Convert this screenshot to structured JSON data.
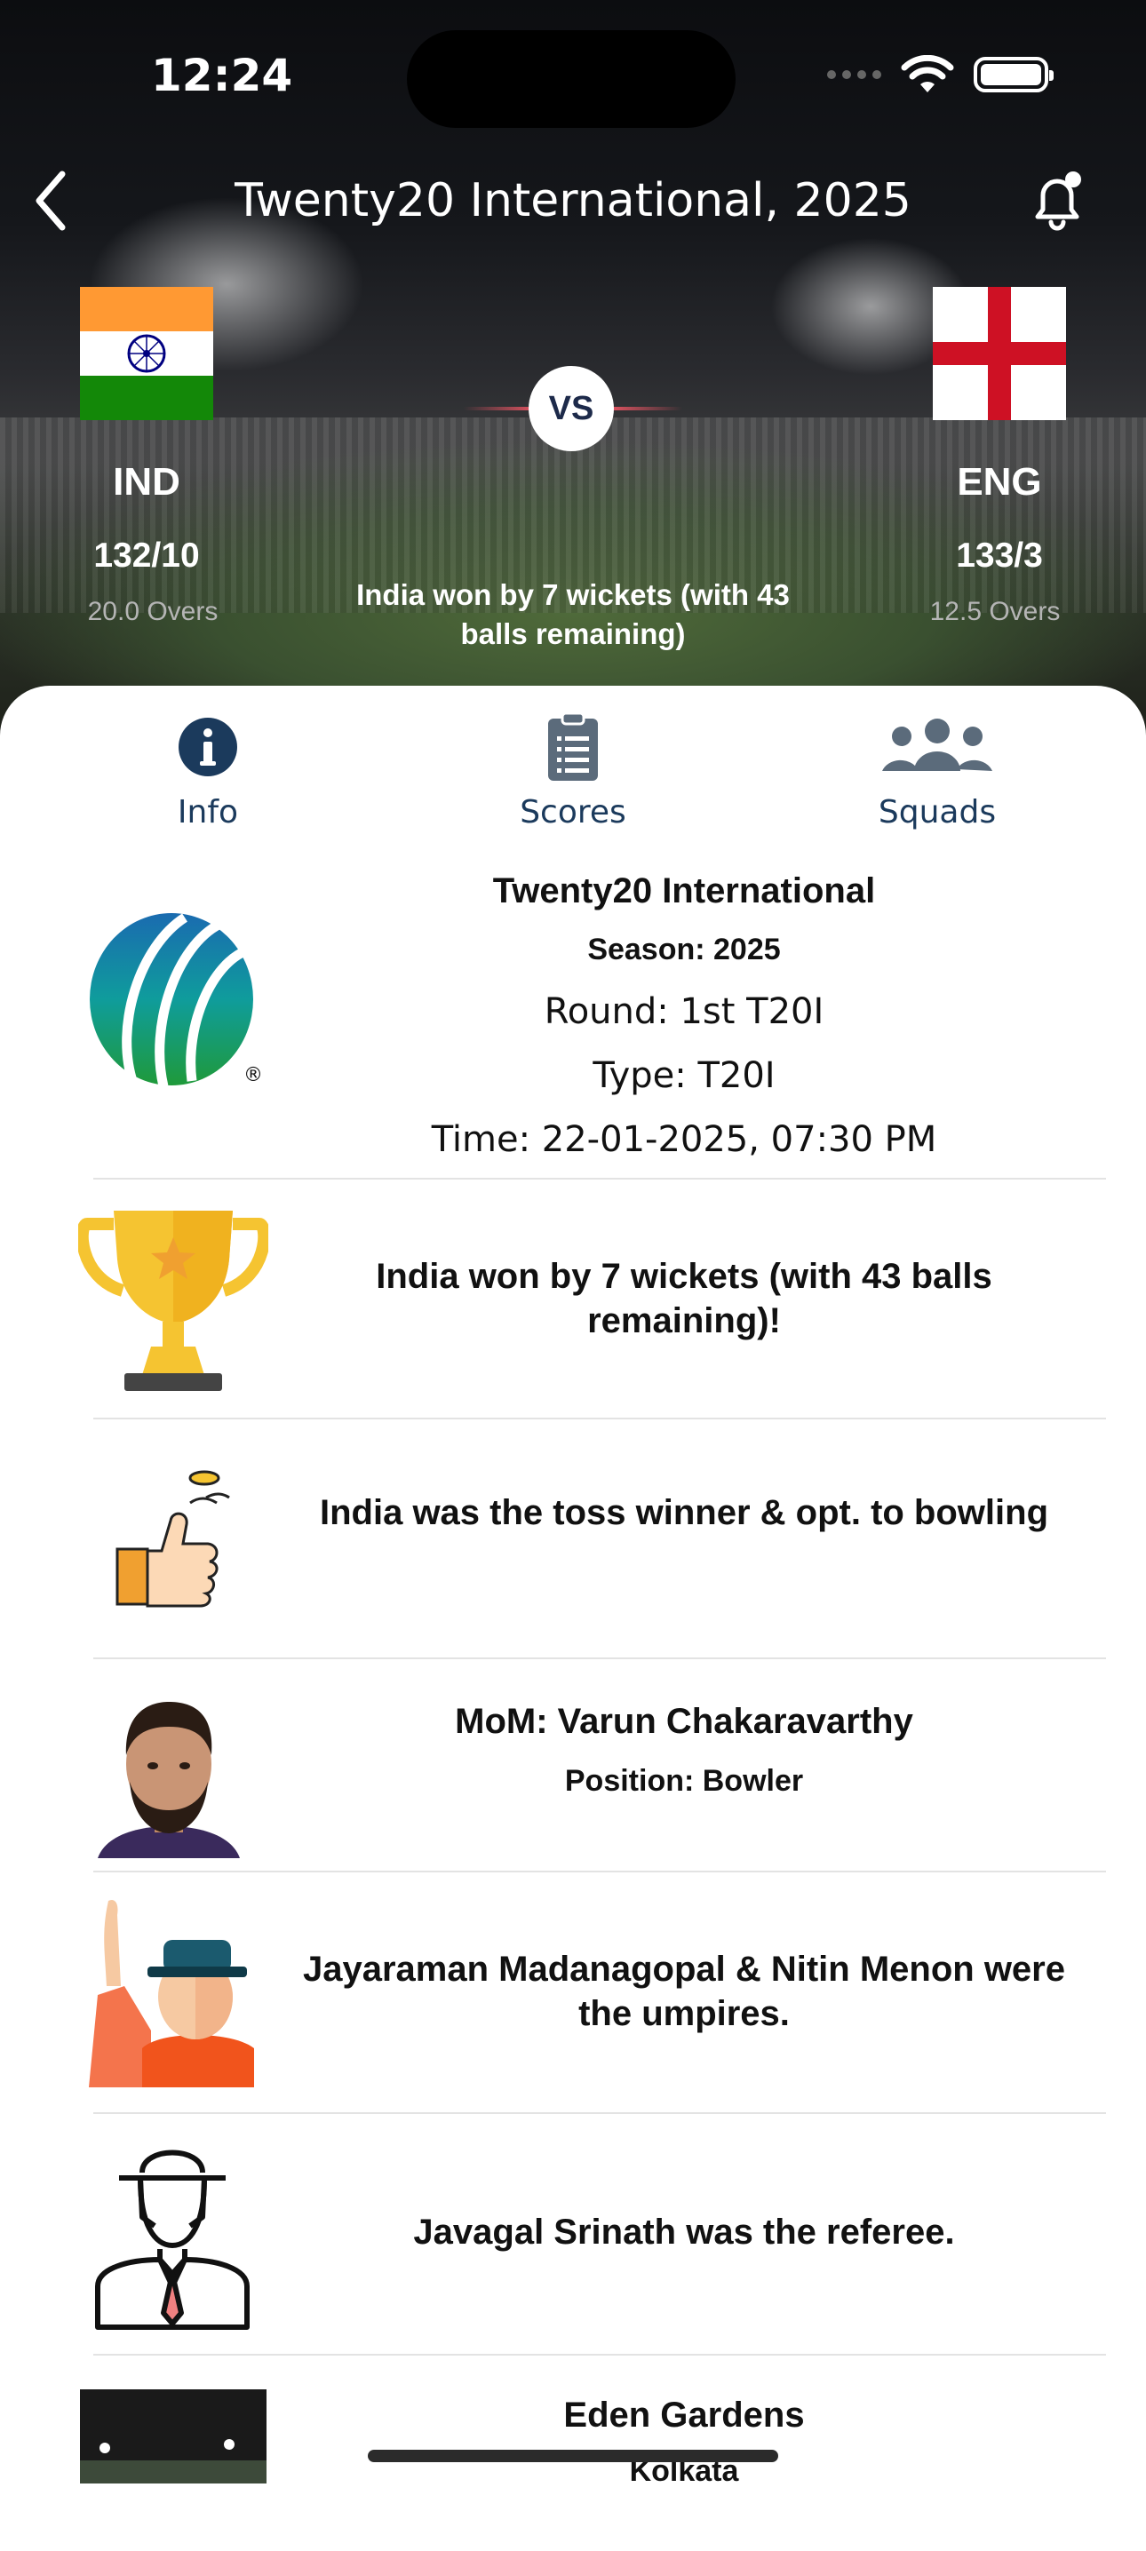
{
  "status_bar": {
    "time": "12:24"
  },
  "header": {
    "title": "Twenty20 International, 2025"
  },
  "match": {
    "home": {
      "code": "IND",
      "score": "132/10",
      "overs": "20.0 Overs"
    },
    "away": {
      "code": "ENG",
      "score": "133/3",
      "overs": "12.5 Overs"
    },
    "vs_label": "VS",
    "result": "India won by 7 wickets (with 43 balls remaining)"
  },
  "tabs": [
    {
      "label": "Info",
      "icon": "info-icon"
    },
    {
      "label": "Scores",
      "icon": "clipboard-icon"
    },
    {
      "label": "Squads",
      "icon": "group-icon"
    }
  ],
  "info": {
    "competition": "Twenty20 International",
    "season": "Season: 2025",
    "round": "Round: 1st T20I",
    "type": "Type: T20I",
    "time": "Time: 22-01-2025, 07:30 PM",
    "result": "India won by 7 wickets (with 43 balls remaining)!",
    "toss": "India was the toss winner & opt. to bowling",
    "mom": "MoM: Varun Chakaravarthy",
    "mom_position": "Position: Bowler",
    "umpires": "Jayaraman Madanagopal & Nitin Menon were the umpires.",
    "referee": "Javagal Srinath was the referee.",
    "venue": "Eden Gardens",
    "city": "Kolkata"
  },
  "colors": {
    "tab_accent": "#1b3a5c",
    "icon_grey": "#5b6b7b",
    "trophy_gold": "#f5c431",
    "india_saffron": "#ff9933",
    "india_green": "#138808",
    "england_red": "#ce1124"
  }
}
